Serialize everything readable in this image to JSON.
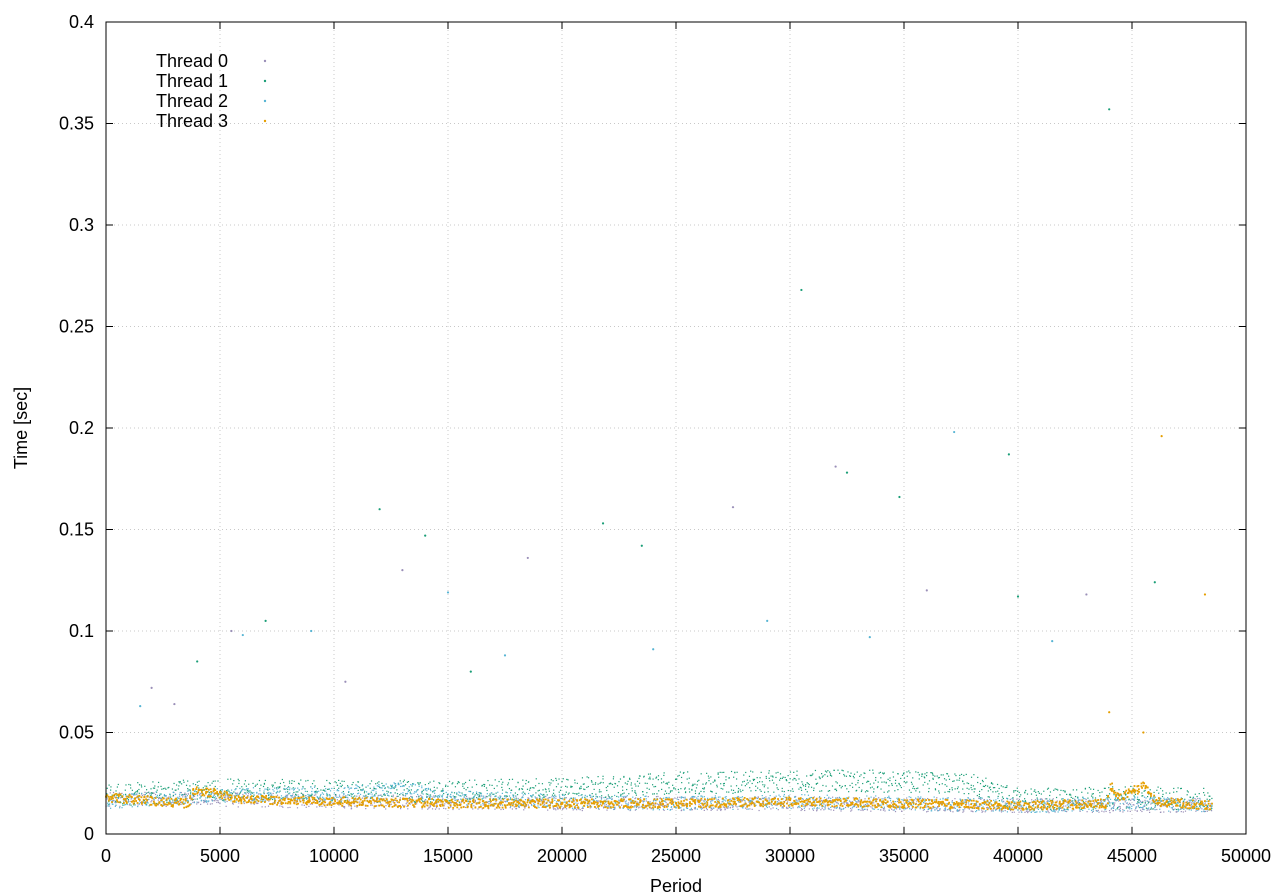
{
  "chart_data": {
    "type": "scatter",
    "title": "",
    "xlabel": "Period",
    "ylabel": "Time [sec]",
    "xlim": [
      0,
      50000
    ],
    "ylim": [
      0,
      0.4
    ],
    "x_ticks": [
      0,
      5000,
      10000,
      15000,
      20000,
      25000,
      30000,
      35000,
      40000,
      45000,
      50000
    ],
    "y_ticks": [
      0,
      0.05,
      0.1,
      0.15,
      0.2,
      0.25,
      0.3,
      0.35,
      0.4
    ],
    "x_tick_labels": [
      "0",
      "5000",
      "10000",
      "15000",
      "20000",
      "25000",
      "30000",
      "35000",
      "40000",
      "45000",
      "50000"
    ],
    "y_tick_labels": [
      "0",
      "0.05",
      "0.1",
      "0.15",
      "0.2",
      "0.25",
      "0.3",
      "0.35",
      "0.4"
    ],
    "grid": true,
    "legend_position": "top-left",
    "series": [
      {
        "name": "Thread 0",
        "color": "#9a8fb8",
        "band": [
          [
            0,
            0.017
          ],
          [
            5000,
            0.017
          ],
          [
            10000,
            0.016
          ],
          [
            20000,
            0.015
          ],
          [
            30000,
            0.015
          ],
          [
            40000,
            0.014
          ],
          [
            48500,
            0.014
          ]
        ],
        "outliers": [
          [
            2000,
            0.072
          ],
          [
            3000,
            0.064
          ],
          [
            5500,
            0.1
          ],
          [
            10500,
            0.075
          ],
          [
            13000,
            0.13
          ],
          [
            18500,
            0.136
          ],
          [
            27500,
            0.161
          ],
          [
            32000,
            0.181
          ],
          [
            36000,
            0.12
          ],
          [
            43000,
            0.118
          ]
        ]
      },
      {
        "name": "Thread 1",
        "color": "#1a9e77",
        "band": [
          [
            0,
            0.019
          ],
          [
            5000,
            0.022
          ],
          [
            10000,
            0.021
          ],
          [
            15000,
            0.021
          ],
          [
            20000,
            0.022
          ],
          [
            25000,
            0.025
          ],
          [
            30000,
            0.026
          ],
          [
            35000,
            0.026
          ],
          [
            38000,
            0.024
          ],
          [
            40000,
            0.017
          ],
          [
            45000,
            0.018
          ],
          [
            48500,
            0.017
          ]
        ],
        "outliers": [
          [
            4000,
            0.085
          ],
          [
            7000,
            0.105
          ],
          [
            12000,
            0.16
          ],
          [
            14000,
            0.147
          ],
          [
            16000,
            0.08
          ],
          [
            21800,
            0.153
          ],
          [
            23500,
            0.142
          ],
          [
            30500,
            0.268
          ],
          [
            32500,
            0.178
          ],
          [
            34800,
            0.166
          ],
          [
            39600,
            0.187
          ],
          [
            40000,
            0.117
          ],
          [
            44000,
            0.357
          ],
          [
            46000,
            0.124
          ]
        ]
      },
      {
        "name": "Thread 2",
        "color": "#56b4d3",
        "band": [
          [
            0,
            0.016
          ],
          [
            5000,
            0.019
          ],
          [
            10000,
            0.02
          ],
          [
            13000,
            0.022
          ],
          [
            15000,
            0.018
          ],
          [
            20000,
            0.016
          ],
          [
            25000,
            0.015
          ],
          [
            30000,
            0.016
          ],
          [
            35000,
            0.015
          ],
          [
            40000,
            0.014
          ],
          [
            45000,
            0.015
          ],
          [
            48500,
            0.014
          ]
        ],
        "outliers": [
          [
            1500,
            0.063
          ],
          [
            6000,
            0.098
          ],
          [
            9000,
            0.1
          ],
          [
            15000,
            0.119
          ],
          [
            17500,
            0.088
          ],
          [
            24000,
            0.091
          ],
          [
            29000,
            0.105
          ],
          [
            33500,
            0.097
          ],
          [
            37200,
            0.198
          ],
          [
            41500,
            0.095
          ]
        ]
      },
      {
        "name": "Thread 3",
        "color": "#e69f00",
        "band": [
          [
            0,
            0.018
          ],
          [
            3600,
            0.015
          ],
          [
            3800,
            0.021
          ],
          [
            5000,
            0.02
          ],
          [
            5500,
            0.017
          ],
          [
            10000,
            0.016
          ],
          [
            15000,
            0.015
          ],
          [
            20000,
            0.015
          ],
          [
            25000,
            0.015
          ],
          [
            30000,
            0.016
          ],
          [
            35000,
            0.015
          ],
          [
            40000,
            0.014
          ],
          [
            43900,
            0.015
          ],
          [
            44000,
            0.024
          ],
          [
            44500,
            0.018
          ],
          [
            45500,
            0.024
          ],
          [
            46000,
            0.016
          ],
          [
            48500,
            0.014
          ]
        ],
        "outliers": [
          [
            44000,
            0.06
          ],
          [
            45500,
            0.05
          ],
          [
            46300,
            0.196
          ],
          [
            48200,
            0.118
          ]
        ]
      }
    ]
  }
}
